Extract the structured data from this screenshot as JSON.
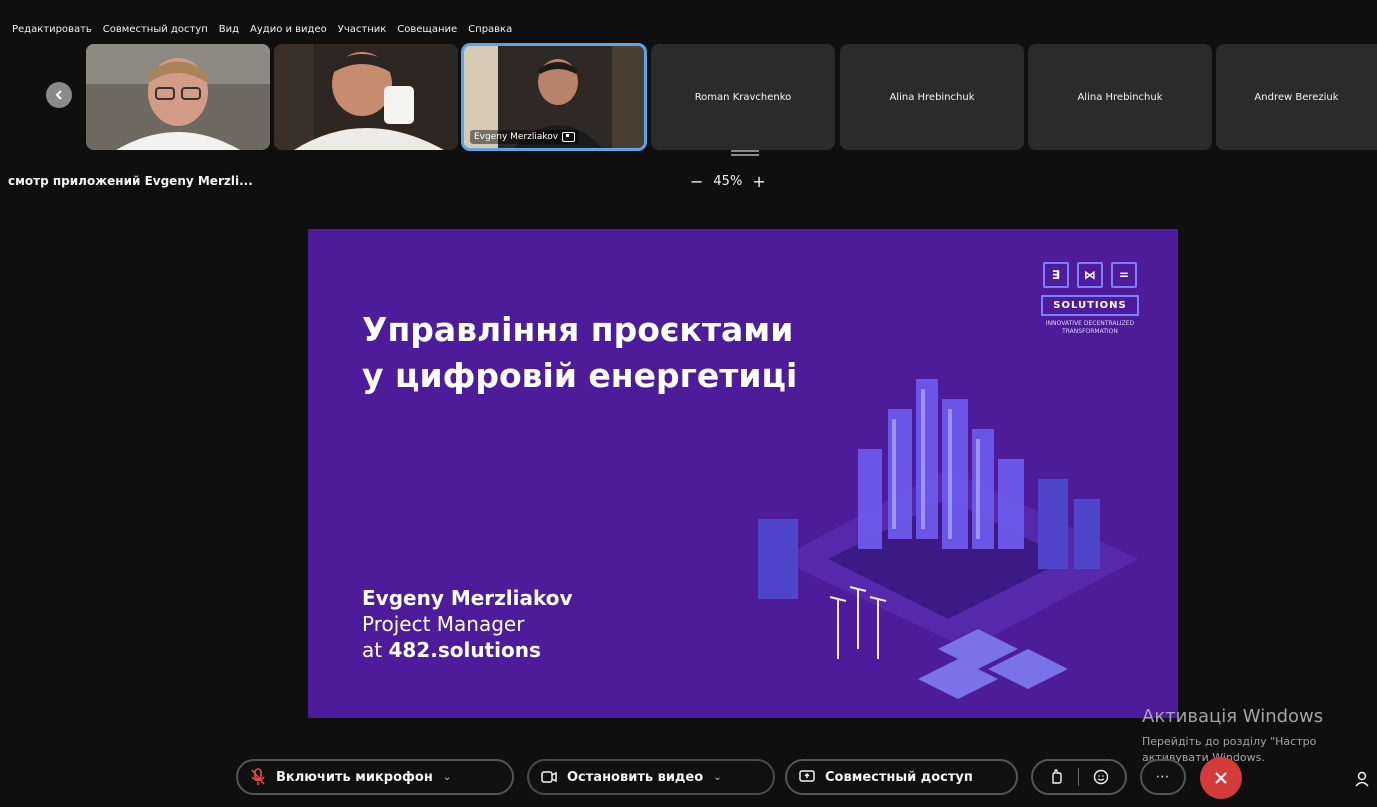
{
  "menu": [
    "Редактировать",
    "Совместный доступ",
    "Вид",
    "Аудио и видео",
    "Участник",
    "Совещание",
    "Справка"
  ],
  "participants": {
    "video_tiles": [
      {
        "name": "participant-1"
      },
      {
        "name": "participant-2"
      },
      {
        "label": "Evgeny Merzliakov"
      }
    ],
    "name_tiles": [
      "Roman Kravchenko",
      "Alina Hrebinchuk",
      "Alina Hrebinchuk",
      "Andrew Bereziuk"
    ]
  },
  "share": {
    "title": "смотр приложений Evgeny Merzli...",
    "zoom": "45%",
    "zoom_out": "−",
    "zoom_in": "+"
  },
  "slide": {
    "title_line1": "Управління проєктами",
    "title_line2": "у цифровій енергетиці",
    "presenter_name": "Evgeny Merzliakov",
    "presenter_role": "Project Manager",
    "presenter_company_prefix": "at",
    "presenter_company": "482.solutions",
    "brand_icons": [
      "∃",
      "⋈",
      "="
    ],
    "brand_name": "SOLUTIONS",
    "brand_tagline_1": "INNOVATIVE DECENTRALIZED",
    "brand_tagline_2": "TRANSFORMATION"
  },
  "toolbar": {
    "mic_label": "Включить микрофон",
    "video_label": "Остановить видео",
    "share_label": "Совместный доступ"
  },
  "activation": {
    "title": "Активація Windows",
    "line1": "Перейдіть до розділу \"Настро",
    "line2": "активувати Windows."
  },
  "colors": {
    "slide_bg": "#4d1c9a",
    "active_outline": "#5aa6e8",
    "end_button": "#d43b3b"
  }
}
